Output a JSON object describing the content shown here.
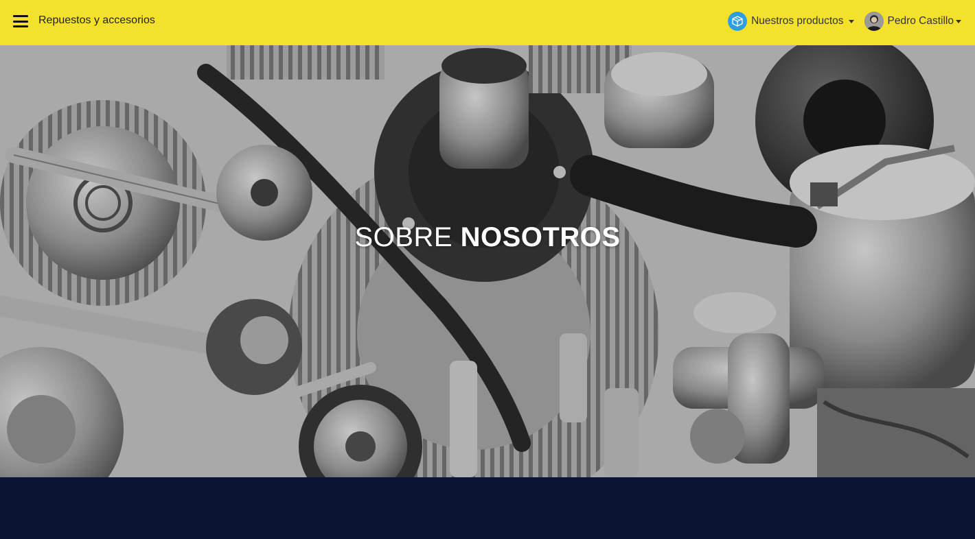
{
  "navbar": {
    "brand": "Repuestos y accesorios",
    "products_label": "Nuestros productos",
    "user_name": "Pedro Castillo",
    "background_color": "#f3e12b",
    "products_icon": "box-icon",
    "menu_icon": "hamburger-icon"
  },
  "hero": {
    "title_light": "SOBRE",
    "title_bold": "NOSOTROS"
  },
  "colors": {
    "footer_band": "#0b1533",
    "products_icon_bg": "#2f9ee0"
  }
}
